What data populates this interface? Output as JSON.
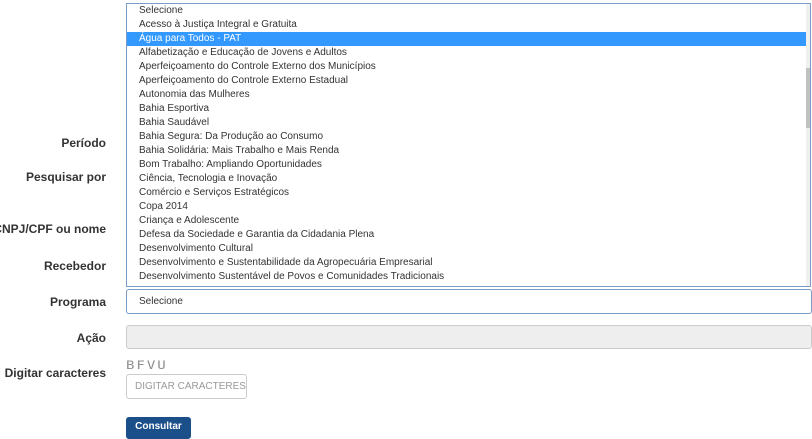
{
  "form": {
    "labels": {
      "periodo": "Período",
      "pesquisar_por": "Pesquisar por",
      "cnpj_cpf": "CNPJ/CPF ou nome",
      "recebedor": "Recebedor",
      "programa": "Programa",
      "acao": "Ação",
      "digitar_caracteres": "Digitar caracteres"
    },
    "programa": {
      "value": "Selecione",
      "options": [
        "Selecione",
        "Acesso à Justiça Integral e Gratuita",
        "Água para Todos - PAT",
        "Alfabetização e Educação de Jovens e Adultos",
        "Aperfeiçoamento do Controle Externo dos Municípios",
        "Aperfeiçoamento do Controle Externo Estadual",
        "Autonomia das Mulheres",
        "Bahia Esportiva",
        "Bahia Saudável",
        "Bahia Segura: Da Produção ao Consumo",
        "Bahia Solidária: Mais Trabalho e Mais Renda",
        "Bom Trabalho: Ampliando Oportunidades",
        "Ciência, Tecnologia e Inovação",
        "Comércio e Serviços Estratégicos",
        "Copa 2014",
        "Criança e Adolescente",
        "Defesa da Sociedade e Garantia da Cidadania Plena",
        "Desenvolvimento Cultural",
        "Desenvolvimento e Sustentabilidade da Agropecuária Empresarial",
        "Desenvolvimento Sustentável de Povos e Comunidades Tradicionais"
      ],
      "highlighted_option": "Água para Todos - PAT"
    },
    "acao": {
      "value": ""
    },
    "captcha": {
      "image_text": "BFVU",
      "input_placeholder": "DIGITAR CARACTERES"
    },
    "submit_label": "Consultar"
  },
  "colors": {
    "highlight": "#3399ff",
    "button": "#1b4f8a",
    "disabled_field": "#eeeeee"
  }
}
